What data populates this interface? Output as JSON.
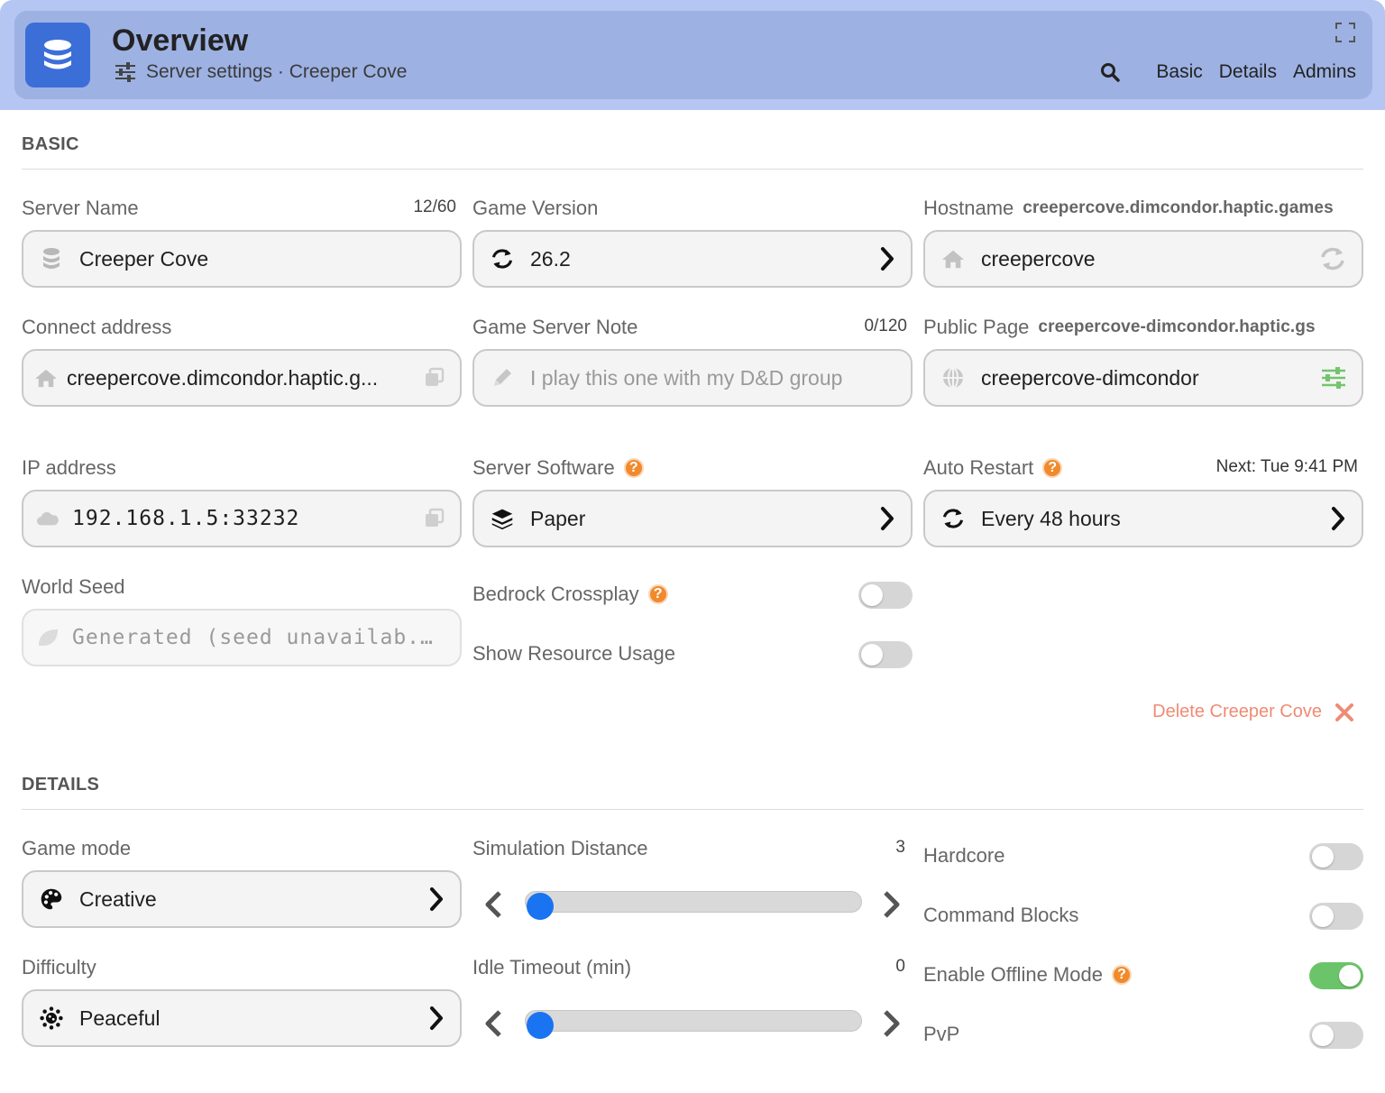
{
  "header": {
    "title": "Overview",
    "subtitle": "Server settings · Creeper Cove",
    "nav": [
      "Basic",
      "Details",
      "Admins"
    ]
  },
  "basic": {
    "section_title": "BASIC",
    "server_name": {
      "label": "Server Name",
      "counter": "12/60",
      "value": "Creeper Cove"
    },
    "game_version": {
      "label": "Game Version",
      "value": "26.2"
    },
    "hostname": {
      "label": "Hostname",
      "full": "creepercove.dimcondor.haptic.games",
      "value": "creepercove"
    },
    "connect_address": {
      "label": "Connect address",
      "value": "creepercove.dimcondor.haptic.g..."
    },
    "note": {
      "label": "Game Server Note",
      "counter": "0/120",
      "placeholder": "I play this one with my D&D group"
    },
    "public_page": {
      "label": "Public Page",
      "full": "creepercove-dimcondor.haptic.gs",
      "value": "creepercove-dimcondor"
    },
    "ip_address": {
      "label": "IP address",
      "value": "192.168.1.5:33232"
    },
    "server_software": {
      "label": "Server Software",
      "value": "Paper"
    },
    "auto_restart": {
      "label": "Auto Restart",
      "next": "Next: Tue 9:41 PM",
      "value": "Every 48 hours"
    },
    "world_seed": {
      "label": "World Seed",
      "value": "Generated (seed unavailab..."
    },
    "bedrock_crossplay": {
      "label": "Bedrock Crossplay",
      "on": false
    },
    "show_resource_usage": {
      "label": "Show Resource Usage",
      "on": false
    },
    "delete_label": "Delete Creeper Cove"
  },
  "details": {
    "section_title": "DETAILS",
    "game_mode": {
      "label": "Game mode",
      "value": "Creative"
    },
    "difficulty": {
      "label": "Difficulty",
      "value": "Peaceful"
    },
    "simulation_distance": {
      "label": "Simulation Distance",
      "value": "3",
      "level": 0.0
    },
    "idle_timeout": {
      "label": "Idle Timeout (min)",
      "value": "0",
      "level": 0.0
    },
    "hardcore": {
      "label": "Hardcore",
      "on": false
    },
    "command_blocks": {
      "label": "Command Blocks",
      "on": false
    },
    "offline_mode": {
      "label": "Enable Offline Mode",
      "on": true
    },
    "pvp": {
      "label": "PvP",
      "on": false
    }
  },
  "colors": {
    "accent": "#1a73f0",
    "header_bg": "#9db1e3",
    "toggle_on": "#6cc46a",
    "help": "#f08a2c",
    "danger": "#ef8b74"
  }
}
